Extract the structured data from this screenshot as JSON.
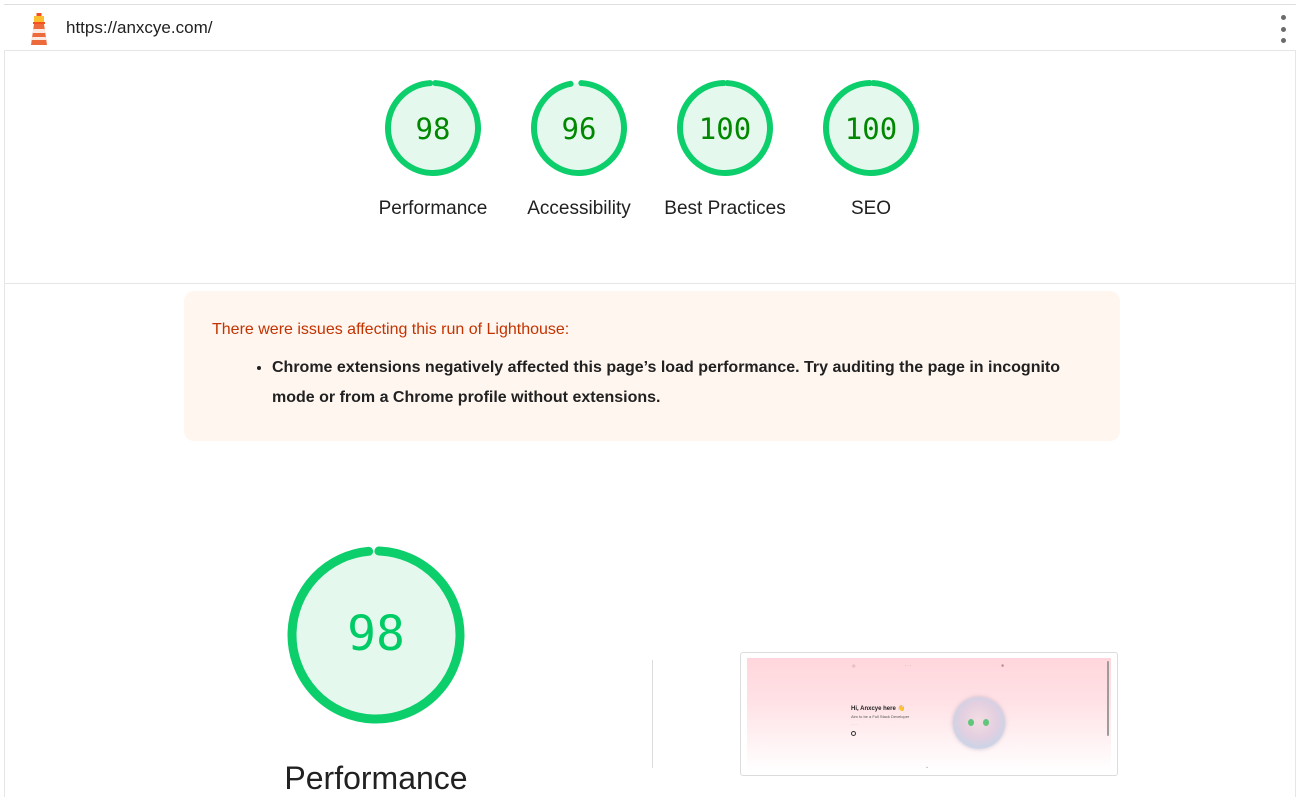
{
  "header": {
    "url": "https://anxcye.com/"
  },
  "categories": [
    {
      "name": "Performance",
      "score": "98",
      "fraction": 0.98
    },
    {
      "name": "Accessibility",
      "score": "96",
      "fraction": 0.96
    },
    {
      "name": "Best Practices",
      "score": "100",
      "fraction": 1.0
    },
    {
      "name": "SEO",
      "score": "100",
      "fraction": 1.0
    }
  ],
  "warning": {
    "title": "There were issues affecting this run of Lighthouse:",
    "items": [
      "Chrome extensions negatively affected this page’s load performance. Try auditing the page in incognito mode or from a Chrome profile without extensions."
    ]
  },
  "performance": {
    "score": "98",
    "fraction": 0.98,
    "label": "Performance"
  },
  "screenshot": {
    "nav_center": "···",
    "heading": "Hi, Anxcye here 👋",
    "subtitle": "Aim to be a Full Stack Developer",
    "small_text": "·······"
  },
  "colors": {
    "pass_ring": "#0cce6b",
    "pass_fill": "#e5f8ee",
    "pass_text": "#008800",
    "warning_bg": "#fff6f0",
    "warning_title": "#c33300"
  }
}
